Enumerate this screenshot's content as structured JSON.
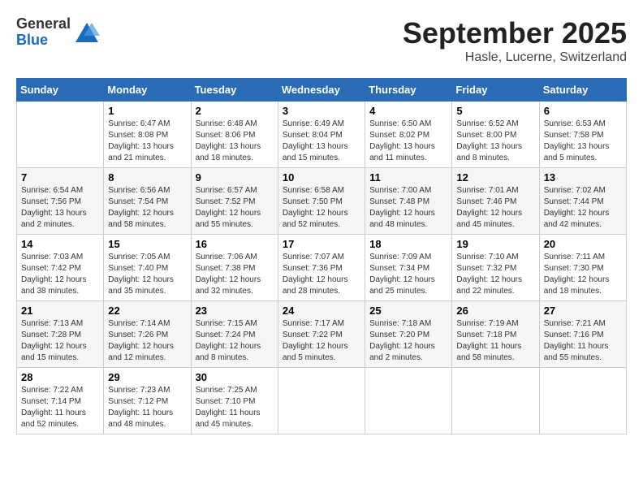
{
  "logo": {
    "general": "General",
    "blue": "Blue"
  },
  "title": "September 2025",
  "location": "Hasle, Lucerne, Switzerland",
  "days_of_week": [
    "Sunday",
    "Monday",
    "Tuesday",
    "Wednesday",
    "Thursday",
    "Friday",
    "Saturday"
  ],
  "weeks": [
    [
      {
        "day": "",
        "info": ""
      },
      {
        "day": "1",
        "info": "Sunrise: 6:47 AM\nSunset: 8:08 PM\nDaylight: 13 hours\nand 21 minutes."
      },
      {
        "day": "2",
        "info": "Sunrise: 6:48 AM\nSunset: 8:06 PM\nDaylight: 13 hours\nand 18 minutes."
      },
      {
        "day": "3",
        "info": "Sunrise: 6:49 AM\nSunset: 8:04 PM\nDaylight: 13 hours\nand 15 minutes."
      },
      {
        "day": "4",
        "info": "Sunrise: 6:50 AM\nSunset: 8:02 PM\nDaylight: 13 hours\nand 11 minutes."
      },
      {
        "day": "5",
        "info": "Sunrise: 6:52 AM\nSunset: 8:00 PM\nDaylight: 13 hours\nand 8 minutes."
      },
      {
        "day": "6",
        "info": "Sunrise: 6:53 AM\nSunset: 7:58 PM\nDaylight: 13 hours\nand 5 minutes."
      }
    ],
    [
      {
        "day": "7",
        "info": "Sunrise: 6:54 AM\nSunset: 7:56 PM\nDaylight: 13 hours\nand 2 minutes."
      },
      {
        "day": "8",
        "info": "Sunrise: 6:56 AM\nSunset: 7:54 PM\nDaylight: 12 hours\nand 58 minutes."
      },
      {
        "day": "9",
        "info": "Sunrise: 6:57 AM\nSunset: 7:52 PM\nDaylight: 12 hours\nand 55 minutes."
      },
      {
        "day": "10",
        "info": "Sunrise: 6:58 AM\nSunset: 7:50 PM\nDaylight: 12 hours\nand 52 minutes."
      },
      {
        "day": "11",
        "info": "Sunrise: 7:00 AM\nSunset: 7:48 PM\nDaylight: 12 hours\nand 48 minutes."
      },
      {
        "day": "12",
        "info": "Sunrise: 7:01 AM\nSunset: 7:46 PM\nDaylight: 12 hours\nand 45 minutes."
      },
      {
        "day": "13",
        "info": "Sunrise: 7:02 AM\nSunset: 7:44 PM\nDaylight: 12 hours\nand 42 minutes."
      }
    ],
    [
      {
        "day": "14",
        "info": "Sunrise: 7:03 AM\nSunset: 7:42 PM\nDaylight: 12 hours\nand 38 minutes."
      },
      {
        "day": "15",
        "info": "Sunrise: 7:05 AM\nSunset: 7:40 PM\nDaylight: 12 hours\nand 35 minutes."
      },
      {
        "day": "16",
        "info": "Sunrise: 7:06 AM\nSunset: 7:38 PM\nDaylight: 12 hours\nand 32 minutes."
      },
      {
        "day": "17",
        "info": "Sunrise: 7:07 AM\nSunset: 7:36 PM\nDaylight: 12 hours\nand 28 minutes."
      },
      {
        "day": "18",
        "info": "Sunrise: 7:09 AM\nSunset: 7:34 PM\nDaylight: 12 hours\nand 25 minutes."
      },
      {
        "day": "19",
        "info": "Sunrise: 7:10 AM\nSunset: 7:32 PM\nDaylight: 12 hours\nand 22 minutes."
      },
      {
        "day": "20",
        "info": "Sunrise: 7:11 AM\nSunset: 7:30 PM\nDaylight: 12 hours\nand 18 minutes."
      }
    ],
    [
      {
        "day": "21",
        "info": "Sunrise: 7:13 AM\nSunset: 7:28 PM\nDaylight: 12 hours\nand 15 minutes."
      },
      {
        "day": "22",
        "info": "Sunrise: 7:14 AM\nSunset: 7:26 PM\nDaylight: 12 hours\nand 12 minutes."
      },
      {
        "day": "23",
        "info": "Sunrise: 7:15 AM\nSunset: 7:24 PM\nDaylight: 12 hours\nand 8 minutes."
      },
      {
        "day": "24",
        "info": "Sunrise: 7:17 AM\nSunset: 7:22 PM\nDaylight: 12 hours\nand 5 minutes."
      },
      {
        "day": "25",
        "info": "Sunrise: 7:18 AM\nSunset: 7:20 PM\nDaylight: 12 hours\nand 2 minutes."
      },
      {
        "day": "26",
        "info": "Sunrise: 7:19 AM\nSunset: 7:18 PM\nDaylight: 11 hours\nand 58 minutes."
      },
      {
        "day": "27",
        "info": "Sunrise: 7:21 AM\nSunset: 7:16 PM\nDaylight: 11 hours\nand 55 minutes."
      }
    ],
    [
      {
        "day": "28",
        "info": "Sunrise: 7:22 AM\nSunset: 7:14 PM\nDaylight: 11 hours\nand 52 minutes."
      },
      {
        "day": "29",
        "info": "Sunrise: 7:23 AM\nSunset: 7:12 PM\nDaylight: 11 hours\nand 48 minutes."
      },
      {
        "day": "30",
        "info": "Sunrise: 7:25 AM\nSunset: 7:10 PM\nDaylight: 11 hours\nand 45 minutes."
      },
      {
        "day": "",
        "info": ""
      },
      {
        "day": "",
        "info": ""
      },
      {
        "day": "",
        "info": ""
      },
      {
        "day": "",
        "info": ""
      }
    ]
  ]
}
